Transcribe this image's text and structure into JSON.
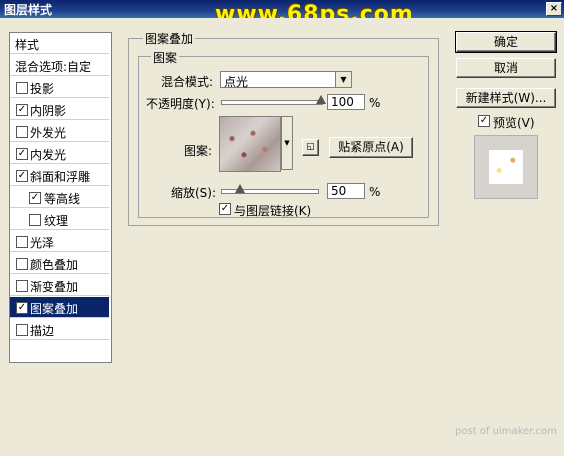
{
  "window": {
    "title": "图层样式",
    "watermark": "www.68ps.com",
    "close_label": "×"
  },
  "styles_panel": {
    "header": "样式",
    "blend_options": "混合选项:自定",
    "items": [
      {
        "label": "投影",
        "checked": false
      },
      {
        "label": "内阴影",
        "checked": true
      },
      {
        "label": "外发光",
        "checked": false
      },
      {
        "label": "内发光",
        "checked": true
      },
      {
        "label": "斜面和浮雕",
        "checked": true
      },
      {
        "label": "等高线",
        "checked": true
      },
      {
        "label": "纹理",
        "checked": false
      },
      {
        "label": "光泽",
        "checked": false
      },
      {
        "label": "颜色叠加",
        "checked": false
      },
      {
        "label": "渐变叠加",
        "checked": false
      },
      {
        "label": "图案叠加",
        "checked": true
      },
      {
        "label": "描边",
        "checked": false
      }
    ],
    "check_mark": "✓"
  },
  "pattern_overlay": {
    "group_title": "图案叠加",
    "subgroup_title": "图案",
    "blend_mode_label": "混合模式:",
    "blend_mode_value": "点光",
    "opacity_label": "不透明度(Y):",
    "opacity_value": "100",
    "opacity_level": 1.0,
    "percent": "%",
    "pattern_label": "图案:",
    "snap_button": "贴紧原点(A)",
    "scale_label": "缩放(S):",
    "scale_value": "50",
    "scale_level": 0.2,
    "link_label": "与图层链接(K)",
    "link_checked": true
  },
  "actions": {
    "ok": "确定",
    "cancel": "取消",
    "new_style": "新建样式(W)...",
    "preview_label": "预览(V)",
    "preview_checked": true
  },
  "footer": {
    "credit": "post of uimaker.com"
  }
}
